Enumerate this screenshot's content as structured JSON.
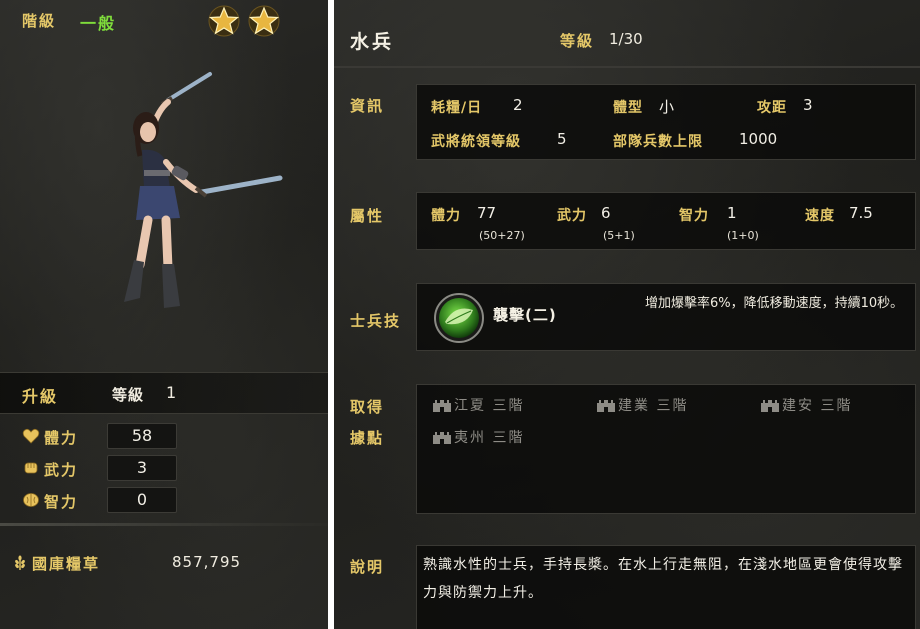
{
  "left": {
    "rank_label": "階級",
    "rank_value": "一般",
    "stars": 2,
    "upgrade": {
      "label": "升級",
      "level_label": "等級",
      "level_value": "1"
    },
    "stats": [
      {
        "name": "體力",
        "value": "58",
        "icon": "heart-icon"
      },
      {
        "name": "武力",
        "value": "3",
        "icon": "fist-icon"
      },
      {
        "name": "智力",
        "value": "0",
        "icon": "brain-icon"
      }
    ],
    "treasury": {
      "label": "國庫糧草",
      "value": "857,795",
      "icon": "grain-icon"
    }
  },
  "right": {
    "unit_name": "水兵",
    "grade_label": "等級",
    "grade_value": "1/30",
    "info": {
      "label": "資訊",
      "rows": [
        [
          {
            "key": "耗糧/日",
            "value": "2"
          },
          {
            "key": "體型",
            "value": "小"
          },
          {
            "key": "攻距",
            "value": "3"
          }
        ],
        [
          {
            "key": "武將統領等級",
            "value": "5"
          },
          {
            "key": "部隊兵數上限",
            "value": "1000"
          }
        ]
      ]
    },
    "attributes": {
      "label": "屬性",
      "items": [
        {
          "key": "體力",
          "value": "77",
          "sub": "(50+27)"
        },
        {
          "key": "武力",
          "value": "6",
          "sub": "(5+1)"
        },
        {
          "key": "智力",
          "value": "1",
          "sub": "(1+0)"
        },
        {
          "key": "速度",
          "value": "7.5",
          "sub": ""
        }
      ]
    },
    "skill": {
      "label": "士兵技",
      "name": "襲擊(二)",
      "description": "增加爆擊率6%，降低移動速度，持續10秒。",
      "icon": "leaf-skill-icon"
    },
    "territories": {
      "label_line1": "取得",
      "label_line2": "據點",
      "places": [
        "江夏 三階",
        "建業 三階",
        "建安 三階",
        "夷州 三階"
      ],
      "icon": "fortress-icon"
    },
    "description": {
      "label": "說明",
      "text": "熟識水性的士兵，手持長槳。在水上行走無阻，在淺水地區更會使得攻擊力與防禦力上升。"
    }
  },
  "colors": {
    "gold_label": "#e4c768",
    "green_rank": "#7fdc3b",
    "text_light": "#f2efe6",
    "text_muted": "#8e8c86",
    "panel_bg": "#242421"
  }
}
